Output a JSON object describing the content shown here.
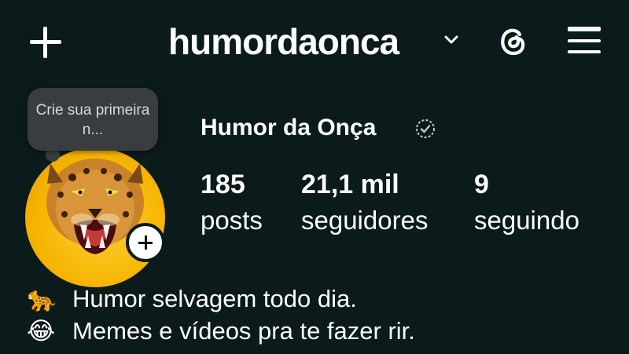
{
  "header": {
    "username": "humordaonca"
  },
  "profile": {
    "display_name": "Humor da Onça",
    "note_text": "Crie sua primeira n...",
    "stats": {
      "posts_value": "185",
      "posts_label": "posts",
      "followers_value": "21,1 mil",
      "followers_label": "seguidores",
      "following_value": "9",
      "following_label": "seguindo"
    }
  },
  "bio": {
    "lines": [
      {
        "emoji": "🐆",
        "text": "Humor selvagem todo dia."
      },
      {
        "emoji": "😂",
        "text": "Memes e vídeos pra te fazer rir."
      }
    ]
  },
  "icons": {
    "create": "plus-icon",
    "account_switch": "chevron-down-icon",
    "threads": "threads-icon",
    "menu": "hamburger-menu-icon",
    "verified": "verified-badge-icon",
    "add_story": "plus-icon"
  },
  "colors": {
    "background": "#0b1a1a",
    "text": "#ffffff",
    "note_bubble": "#3a3d3f",
    "avatar_ring": "#f6b400"
  }
}
